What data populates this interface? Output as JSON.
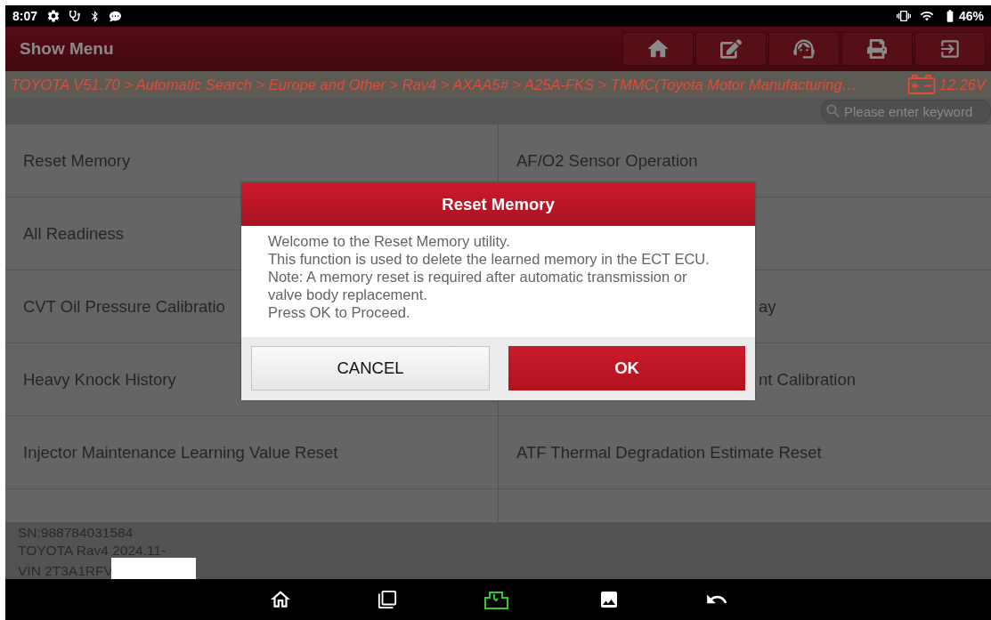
{
  "status_bar": {
    "time": "8:07",
    "battery": "46%"
  },
  "header": {
    "title": "Show Menu"
  },
  "breadcrumb": {
    "path": "TOYOTA V51.70 > Automatic Search > Europe and Other > Rav4 > AXAA5# > A25A-FKS > TMMC(Toyota Motor Manufacturing…",
    "voltage": "12.26V"
  },
  "search": {
    "placeholder": "Please enter keyword"
  },
  "menu_items": [
    {
      "label": "Reset Memory",
      "clipped": false
    },
    {
      "label": "AF/O2 Sensor Operation",
      "clipped": false
    },
    {
      "label": "All Readiness",
      "clipped": false
    },
    {
      "label": "CVT Oil Pressure Calibratio",
      "clipped": false
    },
    {
      "label": "ay",
      "clipped": true
    },
    {
      "label": "Heavy Knock History",
      "clipped": false
    },
    {
      "label": "nt Calibration",
      "clipped": true
    },
    {
      "label": "Injector Maintenance Learning Value Reset",
      "clipped": false
    },
    {
      "label": "ATF Thermal Degradation Estimate Reset",
      "clipped": false
    }
  ],
  "dialog": {
    "title": "Reset Memory",
    "message": [
      "Welcome to the Reset Memory utility.",
      "This function is used to delete the learned memory in the ECT ECU.",
      "Note: A memory reset is required after automatic transmission or valve body replacement.",
      "Press OK to Proceed."
    ],
    "buttons": [
      {
        "label": "CANCEL",
        "kind": "secondary"
      },
      {
        "label": "OK",
        "kind": "primary"
      }
    ]
  },
  "vehicle_info": [
    "SN:988784031584",
    "TOYOTA Rav4 2024.11-",
    "VIN 2T3A1RFV"
  ]
}
